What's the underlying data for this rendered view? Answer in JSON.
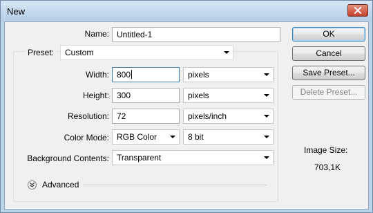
{
  "window": {
    "title": "New"
  },
  "name": {
    "label": "Name:",
    "value": "Untitled-1"
  },
  "preset": {
    "label": "Preset:",
    "value": "Custom"
  },
  "width": {
    "label": "Width:",
    "value": "800",
    "unit": "pixels"
  },
  "height": {
    "label": "Height:",
    "value": "300",
    "unit": "pixels"
  },
  "resolution": {
    "label": "Resolution:",
    "value": "72",
    "unit": "pixels/inch"
  },
  "color_mode": {
    "label": "Color Mode:",
    "value": "RGB Color",
    "depth": "8 bit"
  },
  "background": {
    "label": "Background Contents:",
    "value": "Transparent"
  },
  "advanced": {
    "label": "Advanced"
  },
  "buttons": {
    "ok": "OK",
    "cancel": "Cancel",
    "save_preset": "Save Preset...",
    "delete_preset": "Delete Preset..."
  },
  "image_size": {
    "label": "Image Size:",
    "value": "703,1K"
  },
  "icons": {
    "close": "close-icon",
    "dropdown": "chevron-down-icon",
    "advanced": "double-chevron-down-icon"
  }
}
